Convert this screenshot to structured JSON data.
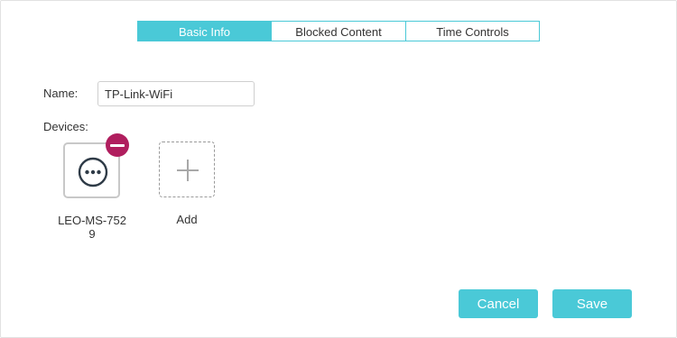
{
  "tabs": [
    {
      "label": "Basic Info",
      "active": true
    },
    {
      "label": "Blocked Content",
      "active": false
    },
    {
      "label": "Time Controls",
      "active": false
    }
  ],
  "form": {
    "name_label": "Name:",
    "name_value": "TP-Link-WiFi",
    "devices_label": "Devices:"
  },
  "devices": [
    {
      "name": "LEO-MS-7529",
      "icon": "more-horizontal-icon",
      "removable": true
    }
  ],
  "add_device": {
    "label": "Add",
    "icon": "plus-icon"
  },
  "buttons": {
    "cancel": "Cancel",
    "save": "Save"
  },
  "colors": {
    "accent": "#4ac9d7",
    "remove": "#b01e5e",
    "border": "#c8c8c8"
  }
}
